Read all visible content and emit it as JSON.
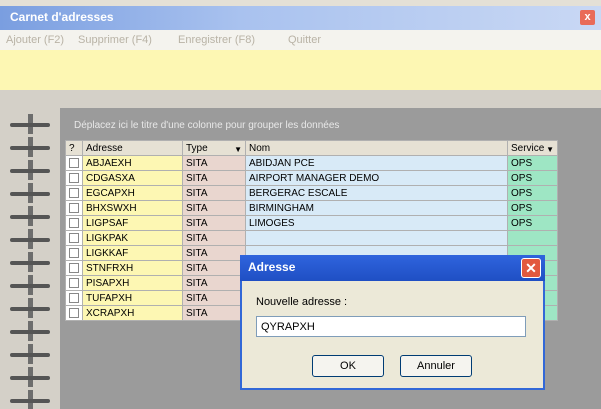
{
  "window": {
    "title": "Carnet d'adresses",
    "close_label": "x"
  },
  "menu": {
    "items": [
      {
        "label": "Ajouter (F2)"
      },
      {
        "label": "Supprimer (F4)"
      },
      {
        "label": "Enregistrer (F8)"
      },
      {
        "label": "Quitter"
      }
    ]
  },
  "grid": {
    "group_hint": "Déplacez ici le titre d'une colonne pour grouper les données",
    "headers": {
      "q": "?",
      "adresse": "Adresse",
      "type": "Type",
      "nom": "Nom",
      "service": "Service"
    },
    "rows": [
      {
        "adresse": "ABJAEXH",
        "type": "SITA",
        "nom": "ABIDJAN PCE",
        "service": "OPS"
      },
      {
        "adresse": "CDGASXA",
        "type": "SITA",
        "nom": "AIRPORT MANAGER DEMO",
        "service": "OPS"
      },
      {
        "adresse": "EGCAPXH",
        "type": "SITA",
        "nom": "BERGERAC ESCALE",
        "service": "OPS"
      },
      {
        "adresse": "BHXSWXH",
        "type": "SITA",
        "nom": "BIRMINGHAM",
        "service": "OPS"
      },
      {
        "adresse": "LIGPSAF",
        "type": "SITA",
        "nom": "LIMOGES",
        "service": "OPS"
      },
      {
        "adresse": "LIGKPAK",
        "type": "SITA",
        "nom": "",
        "service": ""
      },
      {
        "adresse": "LIGKKAF",
        "type": "SITA",
        "nom": "",
        "service": ""
      },
      {
        "adresse": "STNFRXH",
        "type": "SITA",
        "nom": "",
        "service": ""
      },
      {
        "adresse": "PISAPXH",
        "type": "SITA",
        "nom": "",
        "service": ""
      },
      {
        "adresse": "TUFAPXH",
        "type": "SITA",
        "nom": "",
        "service": ""
      },
      {
        "adresse": "XCRAPXH",
        "type": "SITA",
        "nom": "",
        "service": ""
      }
    ]
  },
  "dialog": {
    "title": "Adresse",
    "label": "Nouvelle adresse :",
    "value": "QYRAPXH",
    "ok_label": "OK",
    "cancel_label": "Annuler"
  }
}
